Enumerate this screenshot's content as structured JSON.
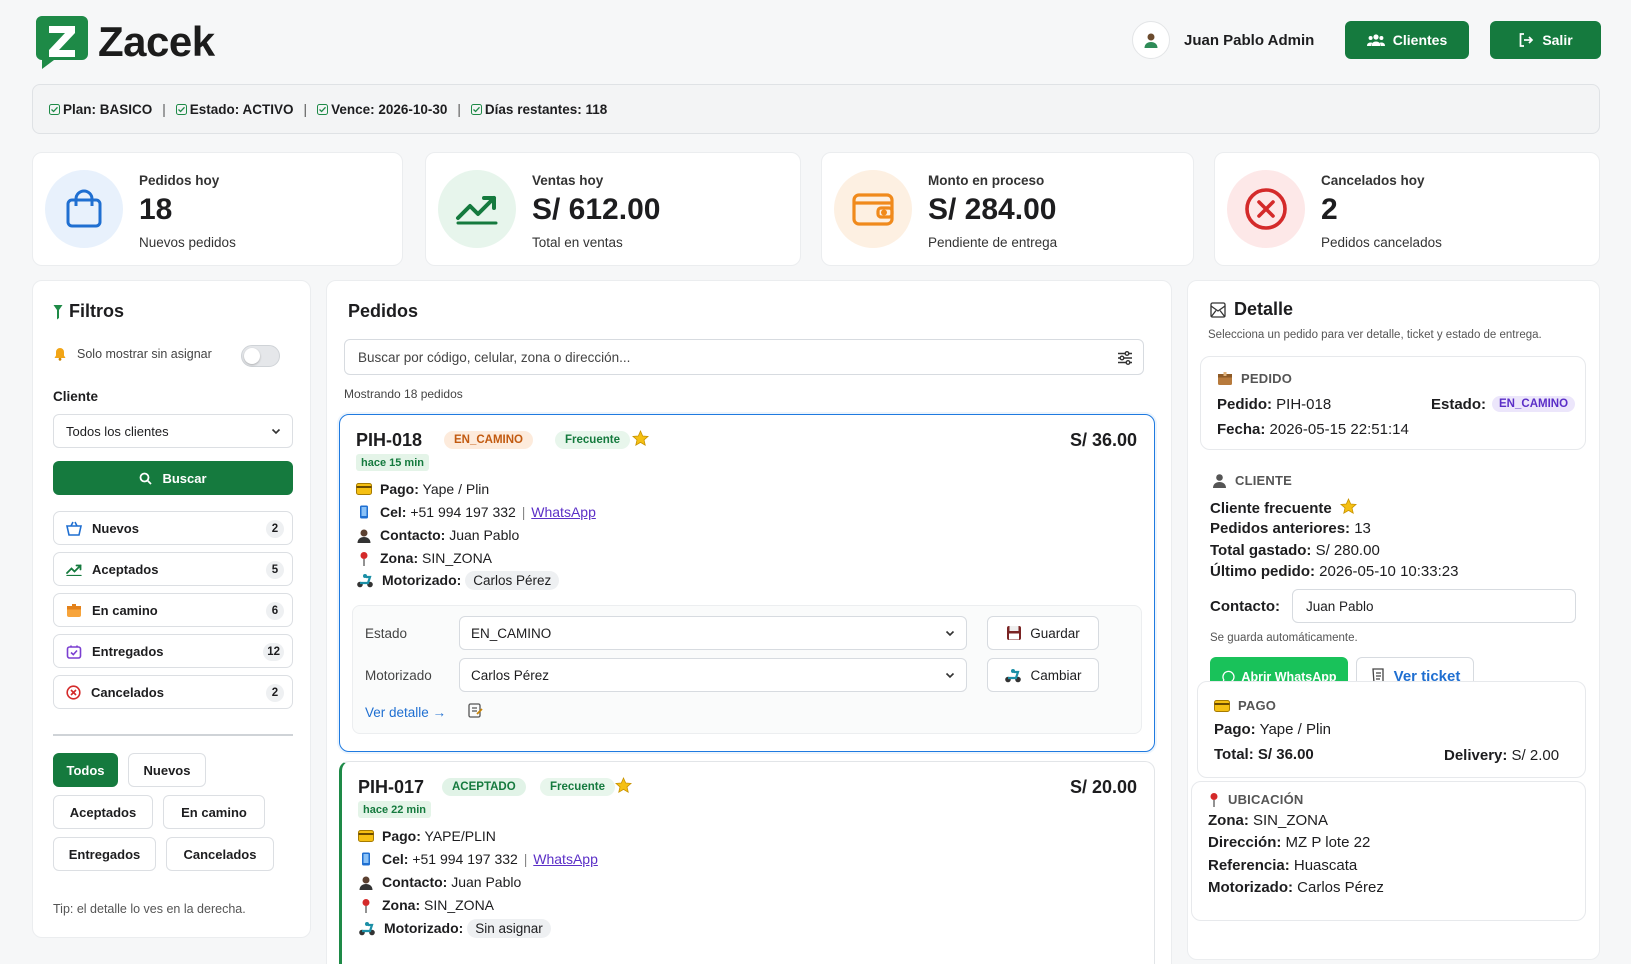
{
  "brand": {
    "name": "Zacek",
    "color": "#157a3e"
  },
  "header": {
    "user_name": "Juan Pablo Admin",
    "clientes_label": "Clientes",
    "salir_label": "Salir"
  },
  "plan": {
    "plan": "Plan: BASICO",
    "estado": "Estado: ACTIVO",
    "vence": "Vence: 2026-10-30",
    "dias": "Días restantes: 118"
  },
  "stats": [
    {
      "label": "Pedidos hoy",
      "value": "18",
      "sub": "Nuevos pedidos",
      "icon": "shopping-bag-icon",
      "color": "#1f6fd1"
    },
    {
      "label": "Ventas hoy",
      "value": "S/ 612.00",
      "sub": "Total en ventas",
      "icon": "trending-up-icon",
      "color": "#157a3e"
    },
    {
      "label": "Monto en proceso",
      "value": "S/ 284.00",
      "sub": "Pendiente de entrega",
      "icon": "wallet-icon",
      "color": "#f08a1c"
    },
    {
      "label": "Cancelados hoy",
      "value": "2",
      "sub": "Pedidos cancelados",
      "icon": "x-circle-icon",
      "color": "#d42a2a"
    }
  ],
  "filters": {
    "title": "Filtros",
    "toggle_label": "Solo mostrar sin asignar",
    "cliente_label": "Cliente",
    "cliente_value": "Todos los clientes",
    "buscar_label": "Buscar",
    "status": [
      {
        "label": "Nuevos",
        "count": "2",
        "icon": "basket-icon"
      },
      {
        "label": "Aceptados",
        "count": "5",
        "icon": "trending-up-icon"
      },
      {
        "label": "En camino",
        "count": "6",
        "icon": "package-icon"
      },
      {
        "label": "Entregados",
        "count": "12",
        "icon": "delivered-box-icon"
      },
      {
        "label": "Cancelados",
        "count": "2",
        "icon": "x-circle-icon"
      }
    ],
    "chips": [
      "Todos",
      "Nuevos",
      "Aceptados",
      "En camino",
      "Entregados",
      "Cancelados"
    ],
    "tip": "Tip: el detalle lo ves en la derecha."
  },
  "orders": {
    "title": "Pedidos",
    "search_placeholder": "Buscar por código, celular, zona o dirección...",
    "showing": "Mostrando 18 pedidos",
    "items": [
      {
        "code": "PIH-018",
        "status": "EN_CAMINO",
        "tag": "Frecuente",
        "price": "S/ 36.00",
        "ago": "hace 15 min",
        "pago_label": "Pago:",
        "pago": "Yape / Plin",
        "cel_label": "Cel:",
        "cel": "+51 994 197 332",
        "whatsapp": "WhatsApp",
        "contacto_label": "Contacto:",
        "contacto": "Juan Pablo",
        "zona_label": "Zona:",
        "zona": "SIN_ZONA",
        "motorizado_label": "Motorizado:",
        "motorizado": "Carlos Pérez",
        "estado_label": "Estado",
        "estado_value": "EN_CAMINO",
        "guardar": "Guardar",
        "moto_label": "Motorizado",
        "moto_value": "Carlos Pérez",
        "cambiar": "Cambiar",
        "ver_detalle": "Ver detalle →"
      },
      {
        "code": "PIH-017",
        "status": "ACEPTADO",
        "tag": "Frecuente",
        "price": "S/ 20.00",
        "ago": "hace 22 min",
        "pago_label": "Pago:",
        "pago": "YAPE/PLIN",
        "cel_label": "Cel:",
        "cel": "+51 994 197 332",
        "whatsapp": "WhatsApp",
        "contacto_label": "Contacto:",
        "contacto": "Juan Pablo",
        "zona_label": "Zona:",
        "zona": "SIN_ZONA",
        "motorizado_label": "Motorizado:",
        "motorizado": "Sin asignar"
      }
    ]
  },
  "detail": {
    "title": "Detalle",
    "subtitle": "Selecciona un pedido para ver detalle, ticket y estado de entrega.",
    "pedido": {
      "header": "PEDIDO",
      "pedido_label": "Pedido:",
      "pedido": "PIH-018",
      "estado_label": "Estado:",
      "estado": "EN_CAMINO",
      "fecha_label": "Fecha:",
      "fecha": "2026-05-15 22:51:14"
    },
    "cliente": {
      "header": "CLIENTE",
      "frecuente": "Cliente frecuente",
      "anteriores_label": "Pedidos anteriores:",
      "anteriores": "13",
      "gastado_label": "Total gastado:",
      "gastado": "S/ 280.00",
      "ultimo_label": "Último pedido:",
      "ultimo": "2026-05-10 10:33:23",
      "contacto_label": "Contacto:",
      "contacto": "Juan Pablo",
      "auto": "Se guarda automáticamente.",
      "whatsapp_btn": "Abrir WhatsApp",
      "ticket_btn": "Ver ticket"
    },
    "pago": {
      "header": "PAGO",
      "pago_label": "Pago:",
      "pago": "Yape / Plin",
      "total_label": "Total:",
      "total": "S/ 36.00",
      "delivery_label": "Delivery:",
      "delivery": "S/ 2.00"
    },
    "ubicacion": {
      "header": "UBICACIÓN",
      "zona_label": "Zona:",
      "zona": "SIN_ZONA",
      "direccion_label": "Dirección:",
      "direccion": "MZ P lote 22",
      "referencia_label": "Referencia:",
      "referencia": "Huascata",
      "motorizado_label": "Motorizado:",
      "motorizado": "Carlos Pérez"
    }
  }
}
